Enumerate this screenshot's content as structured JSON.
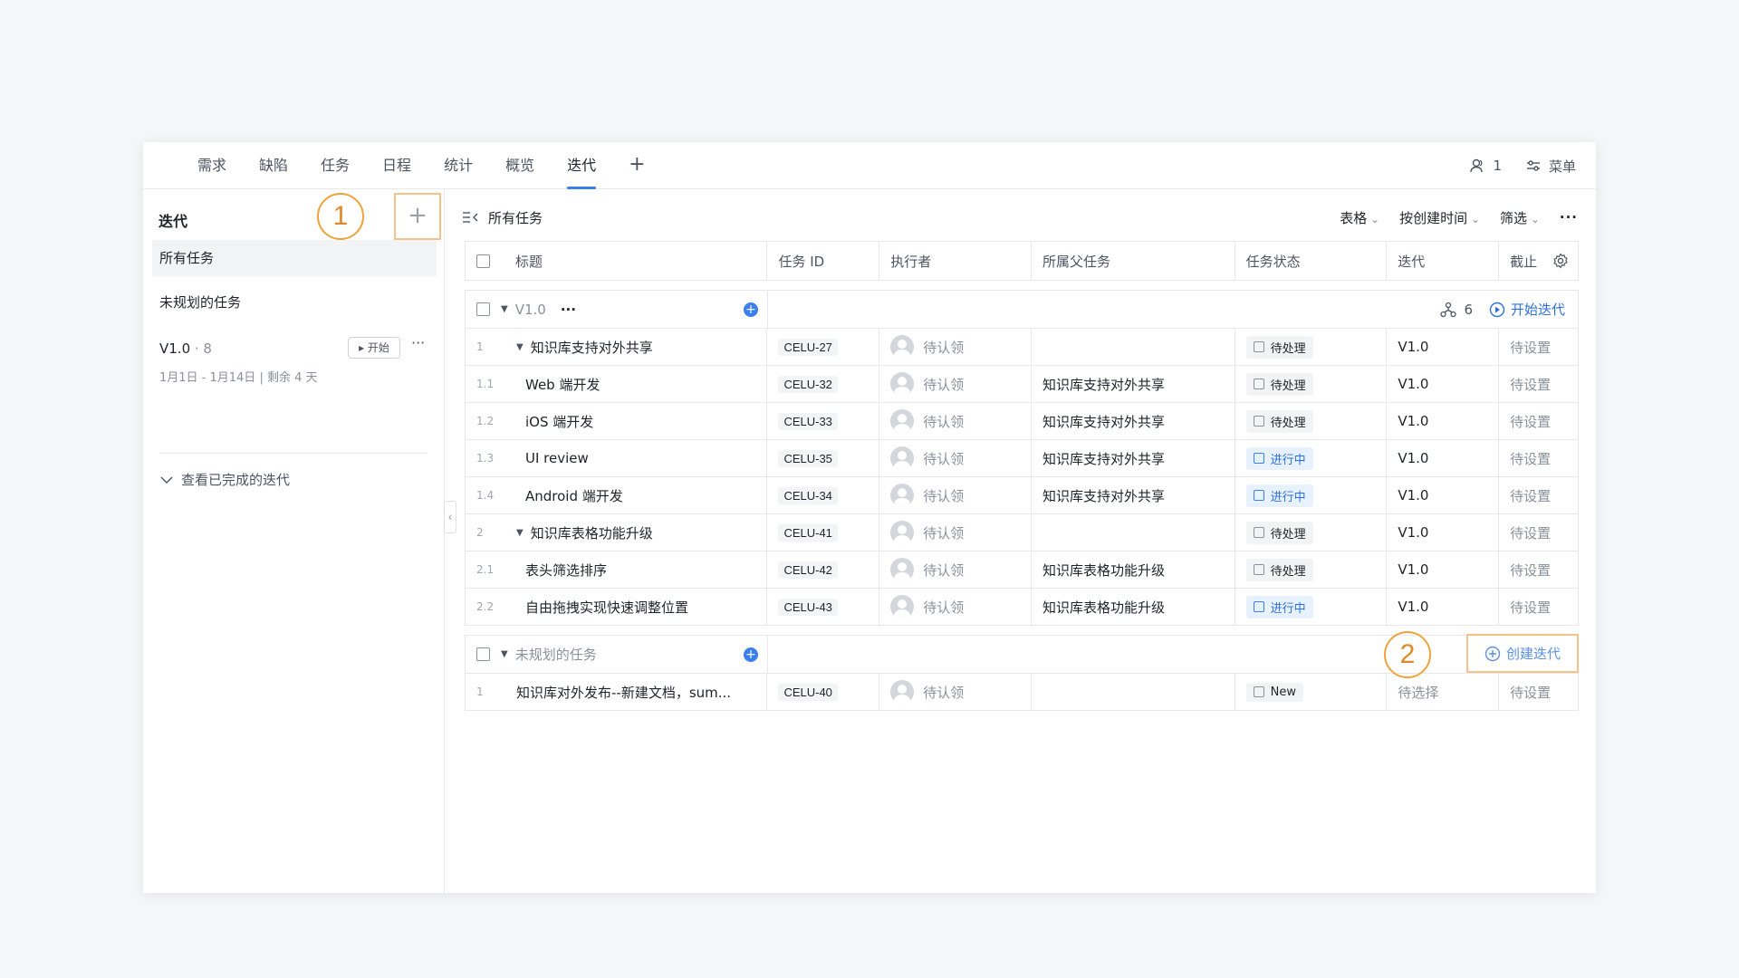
{
  "tabs": [
    "需求",
    "缺陷",
    "任务",
    "日程",
    "统计",
    "概览",
    "迭代"
  ],
  "active_tab_index": 6,
  "tab_add": "+",
  "top_right": {
    "members_count": "1",
    "menu_label": "菜单"
  },
  "sidebar": {
    "title": "迭代",
    "annotation_1": "1",
    "add": "+",
    "items": [
      "所有任务",
      "未规划的任务"
    ],
    "sprint": {
      "name": "V1.0",
      "count": " · 8",
      "start_button": "▸ 开始",
      "more": "···",
      "date": "1月1日 - 1月14日  |  剩余 4 天"
    },
    "view_done": "查看已完成的迭代"
  },
  "toolbar": {
    "title": "所有任务",
    "view": "表格",
    "sort": "按创建时间",
    "filter": "筛选",
    "more": "···"
  },
  "columns": [
    "标题",
    "任务 ID",
    "执行者",
    "所属父任务",
    "任务状态",
    "迭代",
    "截止"
  ],
  "group_v1": {
    "name": "V1.0",
    "more": "···",
    "member_count": "6",
    "start_iteration": "开始迭代"
  },
  "rows": [
    {
      "idx": "1",
      "title": "知识库支持对外共享",
      "expand": true,
      "indent": false,
      "id": "CELU-27",
      "exec": "待认领",
      "parent": "",
      "status": "待处理",
      "status_type": "todo",
      "iter": "V1.0",
      "due": "待设置"
    },
    {
      "idx": "1.1",
      "title": "Web 端开发",
      "expand": false,
      "indent": true,
      "id": "CELU-32",
      "exec": "待认领",
      "parent": "知识库支持对外共享",
      "status": "待处理",
      "status_type": "todo",
      "iter": "V1.0",
      "due": "待设置"
    },
    {
      "idx": "1.2",
      "title": "iOS 端开发",
      "expand": false,
      "indent": true,
      "id": "CELU-33",
      "exec": "待认领",
      "parent": "知识库支持对外共享",
      "status": "待处理",
      "status_type": "todo",
      "iter": "V1.0",
      "due": "待设置"
    },
    {
      "idx": "1.3",
      "title": "UI review",
      "expand": false,
      "indent": true,
      "id": "CELU-35",
      "exec": "待认领",
      "parent": "知识库支持对外共享",
      "status": "进行中",
      "status_type": "doing",
      "iter": "V1.0",
      "due": "待设置"
    },
    {
      "idx": "1.4",
      "title": "Android 端开发",
      "expand": false,
      "indent": true,
      "id": "CELU-34",
      "exec": "待认领",
      "parent": "知识库支持对外共享",
      "status": "进行中",
      "status_type": "doing",
      "iter": "V1.0",
      "due": "待设置"
    },
    {
      "idx": "2",
      "title": "知识库表格功能升级",
      "expand": true,
      "indent": false,
      "id": "CELU-41",
      "exec": "待认领",
      "parent": "",
      "status": "待处理",
      "status_type": "todo",
      "iter": "V1.0",
      "due": "待设置"
    },
    {
      "idx": "2.1",
      "title": "表头筛选排序",
      "expand": false,
      "indent": true,
      "id": "CELU-42",
      "exec": "待认领",
      "parent": "知识库表格功能升级",
      "status": "待处理",
      "status_type": "todo",
      "iter": "V1.0",
      "due": "待设置"
    },
    {
      "idx": "2.2",
      "title": "自由拖拽实现快速调整位置",
      "expand": false,
      "indent": true,
      "id": "CELU-43",
      "exec": "待认领",
      "parent": "知识库表格功能升级",
      "status": "进行中",
      "status_type": "doing",
      "iter": "V1.0",
      "due": "待设置"
    }
  ],
  "group_unplanned": {
    "name": "未规划的任务",
    "annotation_2": "2",
    "create_iteration": "创建迭代"
  },
  "unplanned_rows": [
    {
      "idx": "1",
      "title": "知识库对外发布--新建文档，sum...",
      "id": "CELU-40",
      "exec": "待认领",
      "parent": "",
      "status": "New",
      "status_type": "todo",
      "iter": "待选择",
      "due": "待设置"
    }
  ],
  "colors": {
    "accent": "#3a7ff0",
    "annotation": "#f0a33c"
  }
}
